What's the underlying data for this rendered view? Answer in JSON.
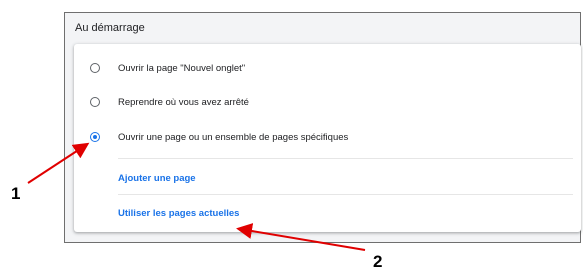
{
  "section": {
    "title": "Au démarrage"
  },
  "options": [
    {
      "label": "Ouvrir la page \"Nouvel onglet\"",
      "selected": false
    },
    {
      "label": "Reprendre où vous avez arrêté",
      "selected": false
    },
    {
      "label": "Ouvrir une page ou un ensemble de pages spécifiques",
      "selected": true
    }
  ],
  "links": {
    "add_page": "Ajouter une page",
    "use_current": "Utiliser les pages actuelles"
  },
  "annotations": {
    "callout_1": "1",
    "callout_2": "2",
    "arrow_color": "#e00000"
  },
  "colors": {
    "accent": "#1a73e8",
    "text": "#202124"
  }
}
